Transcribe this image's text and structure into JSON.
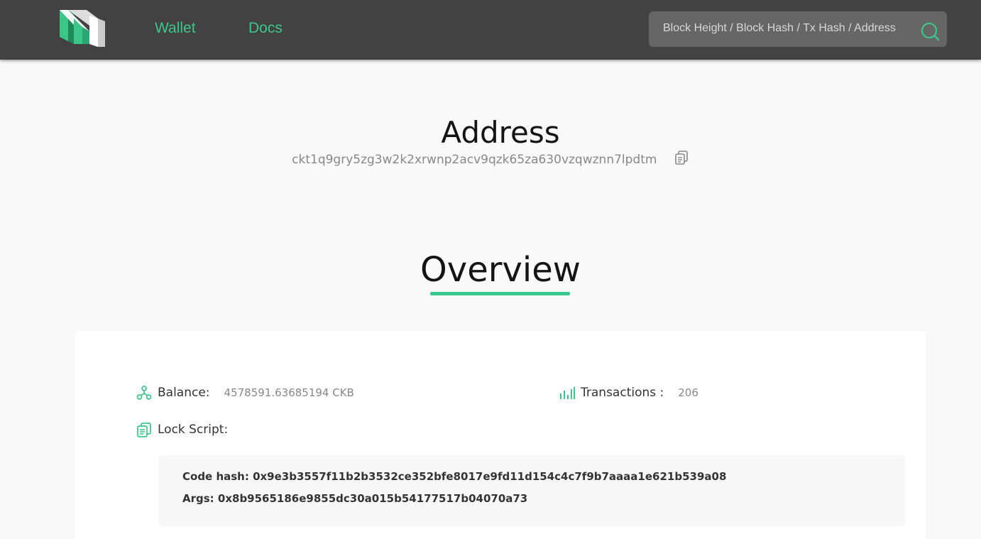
{
  "header": {
    "nav": {
      "wallet_label": "Wallet",
      "docs_label": "Docs"
    },
    "search": {
      "placeholder": "Block Height / Block Hash / Tx Hash / Address"
    }
  },
  "page": {
    "title": "Address",
    "address": "ckt1q9gry5zg3w2k2xrwnp2acv9qzk65za630vzqwznn7lpdtm"
  },
  "overview": {
    "title": "Overview",
    "balance_label": "Balance:",
    "balance_value": "4578591.63685194 CKB",
    "transactions_label": "Transactions :",
    "transactions_value": "206",
    "lock_script_label": "Lock Script:",
    "code_hash_line": "Code hash: 0x9e3b3557f11b2b3532ce352bfe8017e9fd11d154c4c7f9b7aaaa1e621b539a08",
    "args_line": "Args: 0x8b9565186e9855dc30a015b54177517b04070a73"
  },
  "colors": {
    "accent": "#3cc68a",
    "header_bg": "#424242"
  },
  "icons": [
    "logo-icon",
    "search-icon",
    "copy-icon",
    "balance-icon",
    "transactions-icon",
    "lock-script-icon"
  ]
}
